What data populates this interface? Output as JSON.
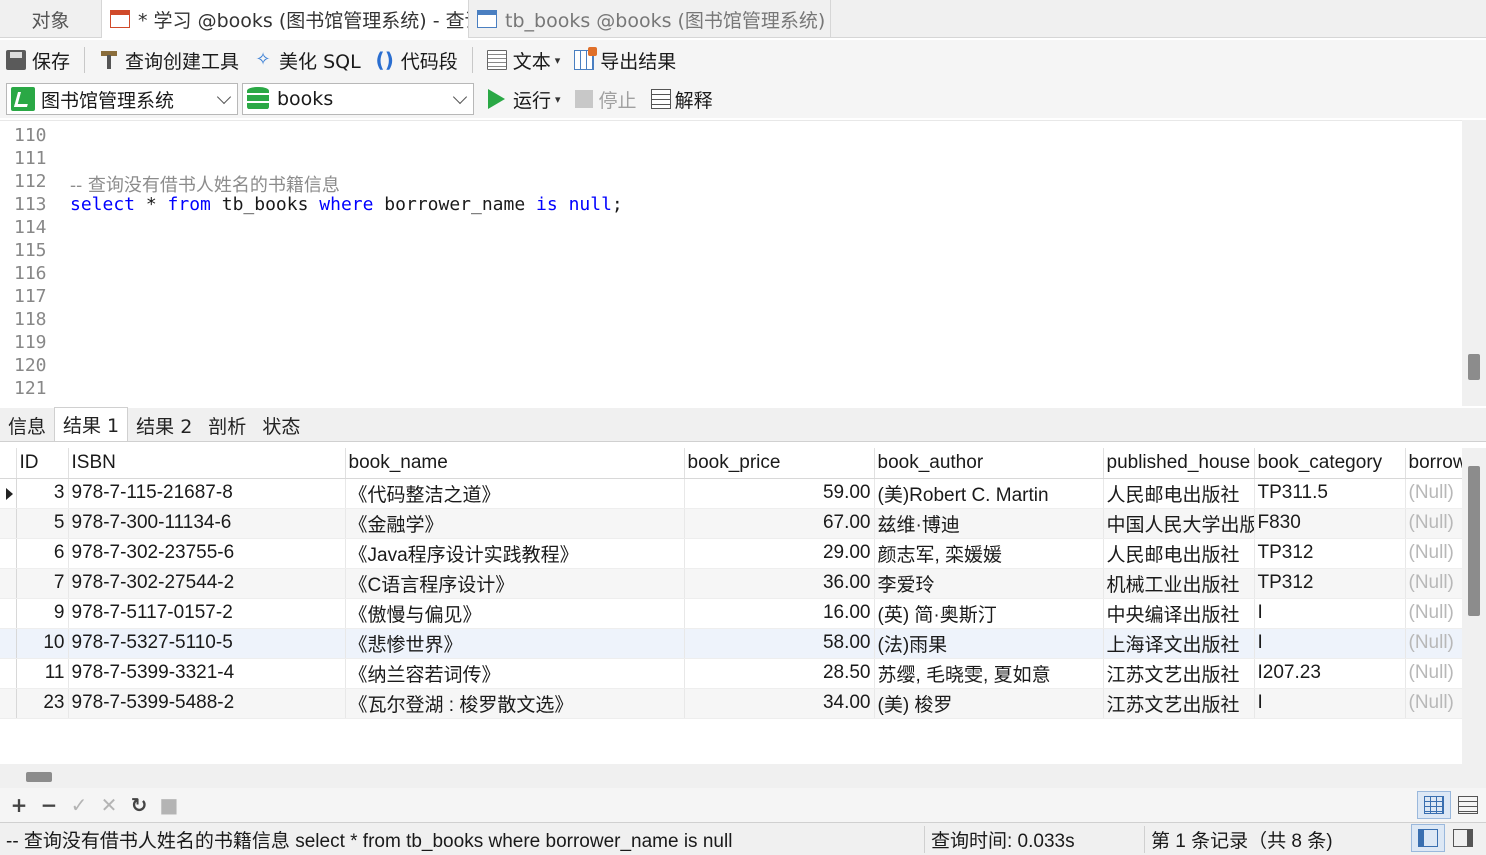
{
  "tabs": [
    {
      "label": "对象"
    },
    {
      "label": "* 学习 @books (图书馆管理系统) - 查询"
    },
    {
      "label": "tb_books @books (图书馆管理系统) -..."
    }
  ],
  "toolbar": {
    "save": "保存",
    "query_builder": "查询创建工具",
    "beautify_sql": "美化 SQL",
    "code_snippet": "代码段",
    "text": "文本",
    "export_result": "导出结果",
    "connection": "图书馆管理系统",
    "database": "books",
    "run": "运行",
    "stop": "停止",
    "explain": "解释"
  },
  "editor": {
    "lines": [
      {
        "num": "110",
        "text": ""
      },
      {
        "num": "111",
        "text": ""
      },
      {
        "num": "112",
        "comment": "-- 查询没有借书人姓名的书籍信息"
      },
      {
        "num": "113",
        "sql": true
      },
      {
        "num": "114",
        "text": ""
      },
      {
        "num": "115",
        "text": ""
      },
      {
        "num": "116",
        "text": ""
      },
      {
        "num": "117",
        "text": ""
      },
      {
        "num": "118",
        "text": ""
      },
      {
        "num": "119",
        "text": ""
      },
      {
        "num": "120",
        "text": ""
      },
      {
        "num": "121",
        "text": ""
      }
    ],
    "sql_tokens": {
      "select": "select",
      "star": " * ",
      "from": "from",
      "table": " tb_books ",
      "where": "where",
      "column": " borrower_name ",
      "is": "is",
      "space": " ",
      "null": "null",
      "semi": ";"
    }
  },
  "result_tabs": [
    "信息",
    "结果 1",
    "结果 2",
    "剖析",
    "状态"
  ],
  "grid": {
    "columns": [
      "ID",
      "ISBN",
      "book_name",
      "book_price",
      "book_author",
      "published_house",
      "book_category",
      "borrower_name"
    ],
    "rows": [
      [
        "3",
        "978-7-115-21687-8",
        "《代码整洁之道》",
        "59.00",
        "(美)Robert C. Martin",
        "人民邮电出版社",
        "TP311.5",
        "(Null)"
      ],
      [
        "5",
        "978-7-300-11134-6",
        "《金融学》",
        "67.00",
        "兹维·博迪",
        "中国人民大学出版社",
        "F830",
        "(Null)"
      ],
      [
        "6",
        "978-7-302-23755-6",
        "《Java程序设计实践教程》",
        "29.00",
        "颜志军, 栾媛媛",
        "人民邮电出版社",
        "TP312",
        "(Null)"
      ],
      [
        "7",
        "978-7-302-27544-2",
        "《C语言程序设计》",
        "36.00",
        "李爱玲",
        "机械工业出版社",
        "TP312",
        "(Null)"
      ],
      [
        "9",
        "978-7-5117-0157-2",
        "《傲慢与偏见》",
        "16.00",
        "(英) 简·奥斯汀",
        "中央编译出版社",
        "I",
        "(Null)"
      ],
      [
        "10",
        "978-7-5327-5110-5",
        "《悲惨世界》",
        "58.00",
        "(法)雨果",
        "上海译文出版社",
        "I",
        "(Null)"
      ],
      [
        "11",
        "978-7-5399-3321-4",
        "《纳兰容若词传》",
        "28.50",
        "苏缨, 毛晓雯, 夏如意",
        "江苏文艺出版社",
        "I207.23",
        "(Null)"
      ],
      [
        "23",
        "978-7-5399-5488-2",
        "《瓦尔登湖 : 梭罗散文选》",
        "34.00",
        "(美) 梭罗",
        "江苏文艺出版社",
        "I",
        "(Null)"
      ]
    ]
  },
  "status": {
    "query": "-- 查询没有借书人姓名的书籍信息 select * from tb_books where borrower_name is null",
    "time": "查询时间: 0.033s",
    "records": "第 1 条记录（共 8 条)"
  }
}
